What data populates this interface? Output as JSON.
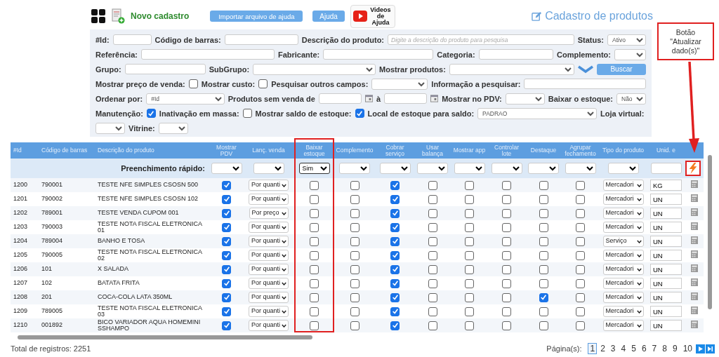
{
  "toolbar": {
    "new_record": "Novo cadastro",
    "import_button": "Importar arquivo de ajuda",
    "help_button": "Ajuda",
    "video_help": "Videos de Ajuda",
    "page_title": "Cadastro de produtos"
  },
  "annotation": {
    "text": "Botão \"Atualizar dado(s)\""
  },
  "filters": [
    [
      {
        "kind": "label",
        "text": "#Id:"
      },
      {
        "kind": "input"
      },
      {
        "kind": "label",
        "text": "Código de barras:"
      },
      {
        "kind": "input"
      },
      {
        "kind": "label",
        "text": "Descrição do produto:"
      },
      {
        "kind": "input",
        "placeholder": "Digite a descrição do produto para pesquisa"
      },
      {
        "kind": "label",
        "text": "Status:"
      },
      {
        "kind": "select",
        "value": "Ativo"
      }
    ],
    [
      {
        "kind": "label",
        "text": "Referência:"
      },
      {
        "kind": "input"
      },
      {
        "kind": "label",
        "text": "Fabricante:"
      },
      {
        "kind": "input"
      },
      {
        "kind": "label",
        "text": "Categoria:"
      },
      {
        "kind": "input"
      },
      {
        "kind": "label",
        "text": "Complemento:"
      },
      {
        "kind": "select"
      }
    ],
    [
      {
        "kind": "label",
        "text": "Grupo:"
      },
      {
        "kind": "input"
      },
      {
        "kind": "label",
        "text": "SubGrupo:"
      },
      {
        "kind": "select"
      },
      {
        "kind": "label",
        "text": "Mostrar produtos:"
      },
      {
        "kind": "select"
      },
      {
        "kind": "chevron"
      },
      {
        "kind": "button",
        "text": "Buscar"
      }
    ],
    [
      {
        "kind": "label",
        "text": "Mostrar preço de venda:"
      },
      {
        "kind": "checkbox",
        "checked": false
      },
      {
        "kind": "label",
        "text": "Mostrar custo:"
      },
      {
        "kind": "checkbox",
        "checked": false
      },
      {
        "kind": "label",
        "text": "Pesquisar outros campos:"
      },
      {
        "kind": "select"
      },
      {
        "kind": "label",
        "text": "Informação a pesquisar:"
      },
      {
        "kind": "input"
      }
    ],
    [
      {
        "kind": "label",
        "text": "Ordenar por:"
      },
      {
        "kind": "select",
        "value": "#Id"
      },
      {
        "kind": "label",
        "text": "Produtos sem venda de"
      },
      {
        "kind": "input"
      },
      {
        "kind": "calendar"
      },
      {
        "kind": "label",
        "text": "à"
      },
      {
        "kind": "input"
      },
      {
        "kind": "calendar"
      },
      {
        "kind": "label",
        "text": "Mostrar no PDV:"
      },
      {
        "kind": "select"
      },
      {
        "kind": "label",
        "text": "Baixar o estoque:"
      },
      {
        "kind": "select",
        "value": "Não"
      }
    ],
    [
      {
        "kind": "label",
        "text": "Manutenção:"
      },
      {
        "kind": "checkbox",
        "checked": true
      },
      {
        "kind": "label",
        "text": "Inativação em massa:"
      },
      {
        "kind": "checkbox",
        "checked": false
      },
      {
        "kind": "label",
        "text": "Mostrar saldo de estoque:"
      },
      {
        "kind": "checkbox",
        "checked": true
      },
      {
        "kind": "label",
        "text": "Local de estoque para saldo:"
      },
      {
        "kind": "select",
        "value": "PADRAO"
      },
      {
        "kind": "label",
        "text": "Loja virtual:"
      }
    ],
    [
      {
        "kind": "select"
      },
      {
        "kind": "label",
        "text": "Vitrine:"
      },
      {
        "kind": "select"
      }
    ]
  ],
  "table": {
    "columns": [
      "#Id",
      "Código de barras",
      "Descrição do produto",
      "Mostrar PDV",
      "Lanç. venda",
      "Baixar estoque",
      "Complemento",
      "Cobrar serviço",
      "Usar balança",
      "Mostrar app",
      "Controlar lote",
      "Destaque",
      "Agrupar fechamento",
      "Tipo do produto",
      "Unid. e"
    ],
    "quick_fill": {
      "label": "Preenchimento rápido:",
      "fields": [
        {
          "kind": "select"
        },
        {
          "kind": "select"
        },
        {
          "kind": "select",
          "value": "Sim"
        },
        {
          "kind": "select"
        },
        {
          "kind": "select"
        },
        {
          "kind": "select"
        },
        {
          "kind": "select"
        },
        {
          "kind": "select"
        },
        {
          "kind": "select"
        },
        {
          "kind": "select"
        },
        {
          "kind": "select"
        },
        {
          "kind": "input"
        }
      ]
    },
    "rows": [
      {
        "id": "1200",
        "barcode": "790001",
        "description": "TESTE NFE SIMPLES CSOSN 500",
        "show_pdv": true,
        "sale_mode": "Por quanti",
        "lower_stock": false,
        "complement": false,
        "charge_service": true,
        "use_scale": false,
        "show_app": false,
        "lot_control": false,
        "featured": false,
        "group_closing": false,
        "product_type": "Mercadori",
        "unit": "KG"
      },
      {
        "id": "1201",
        "barcode": "790002",
        "description": "TESTE NFE SIMPLES CSOSN 102",
        "show_pdv": true,
        "sale_mode": "Por quanti",
        "lower_stock": false,
        "complement": false,
        "charge_service": true,
        "use_scale": false,
        "show_app": false,
        "lot_control": false,
        "featured": false,
        "group_closing": false,
        "product_type": "Mercadori",
        "unit": "UN"
      },
      {
        "id": "1202",
        "barcode": "789001",
        "description": "TESTE VENDA CUPOM 001",
        "show_pdv": true,
        "sale_mode": "Por preço",
        "lower_stock": false,
        "complement": false,
        "charge_service": true,
        "use_scale": false,
        "show_app": false,
        "lot_control": false,
        "featured": false,
        "group_closing": false,
        "product_type": "Mercadori",
        "unit": "UN"
      },
      {
        "id": "1203",
        "barcode": "790003",
        "description": "TESTE NOTA FISCAL ELETRONICA 01",
        "show_pdv": true,
        "sale_mode": "Por quanti",
        "lower_stock": false,
        "complement": false,
        "charge_service": true,
        "use_scale": false,
        "show_app": false,
        "lot_control": false,
        "featured": false,
        "group_closing": false,
        "product_type": "Mercadori",
        "unit": "UN"
      },
      {
        "id": "1204",
        "barcode": "789004",
        "description": "BANHO E TOSA",
        "show_pdv": true,
        "sale_mode": "Por quanti",
        "lower_stock": false,
        "complement": false,
        "charge_service": true,
        "use_scale": false,
        "show_app": false,
        "lot_control": false,
        "featured": false,
        "group_closing": false,
        "product_type": "Serviço",
        "unit": "UN"
      },
      {
        "id": "1205",
        "barcode": "790005",
        "description": "TESTE NOTA FISCAL ELETRONICA 02",
        "show_pdv": true,
        "sale_mode": "Por quanti",
        "lower_stock": false,
        "complement": false,
        "charge_service": true,
        "use_scale": false,
        "show_app": false,
        "lot_control": false,
        "featured": false,
        "group_closing": false,
        "product_type": "Mercadori",
        "unit": "UN"
      },
      {
        "id": "1206",
        "barcode": "101",
        "description": "X SALADA",
        "show_pdv": true,
        "sale_mode": "Por quanti",
        "lower_stock": false,
        "complement": false,
        "charge_service": true,
        "use_scale": false,
        "show_app": false,
        "lot_control": false,
        "featured": false,
        "group_closing": false,
        "product_type": "Mercadori",
        "unit": "UN"
      },
      {
        "id": "1207",
        "barcode": "102",
        "description": "BATATA FRITA",
        "show_pdv": true,
        "sale_mode": "Por quanti",
        "lower_stock": false,
        "complement": false,
        "charge_service": true,
        "use_scale": false,
        "show_app": false,
        "lot_control": false,
        "featured": false,
        "group_closing": false,
        "product_type": "Mercadori",
        "unit": "UN"
      },
      {
        "id": "1208",
        "barcode": "201",
        "description": "COCA-COLA LATA 350ML",
        "show_pdv": true,
        "sale_mode": "Por quanti",
        "lower_stock": false,
        "complement": false,
        "charge_service": true,
        "use_scale": false,
        "show_app": false,
        "lot_control": false,
        "featured": true,
        "group_closing": false,
        "product_type": "Mercadori",
        "unit": "UN"
      },
      {
        "id": "1209",
        "barcode": "789005",
        "description": "TESTE NOTA FISCAL ELETRONICA 03",
        "show_pdv": true,
        "sale_mode": "Por quanti",
        "lower_stock": false,
        "complement": false,
        "charge_service": true,
        "use_scale": false,
        "show_app": false,
        "lot_control": false,
        "featured": false,
        "group_closing": false,
        "product_type": "Mercadori",
        "unit": "UN"
      },
      {
        "id": "1210",
        "barcode": "001892",
        "description": "BICO VARIADOR AQUA HOMEMINI SSHAMPO",
        "show_pdv": true,
        "sale_mode": "Por quanti",
        "lower_stock": false,
        "complement": false,
        "charge_service": true,
        "use_scale": false,
        "show_app": false,
        "lot_control": false,
        "featured": false,
        "group_closing": false,
        "product_type": "Mercadori",
        "unit": "UN"
      }
    ]
  },
  "footer": {
    "total": "Total de registros: 2251",
    "pages_label": "Página(s):",
    "pages": [
      {
        "label": "1",
        "selected": true
      },
      {
        "label": "2",
        "selected": false
      },
      {
        "label": "3",
        "selected": false
      },
      {
        "label": "4",
        "selected": false
      },
      {
        "label": "5",
        "selected": false
      },
      {
        "label": "6",
        "selected": false
      },
      {
        "label": "7",
        "selected": false
      },
      {
        "label": "8",
        "selected": false
      },
      {
        "label": "9",
        "selected": false
      },
      {
        "label": "10",
        "selected": false
      }
    ]
  }
}
